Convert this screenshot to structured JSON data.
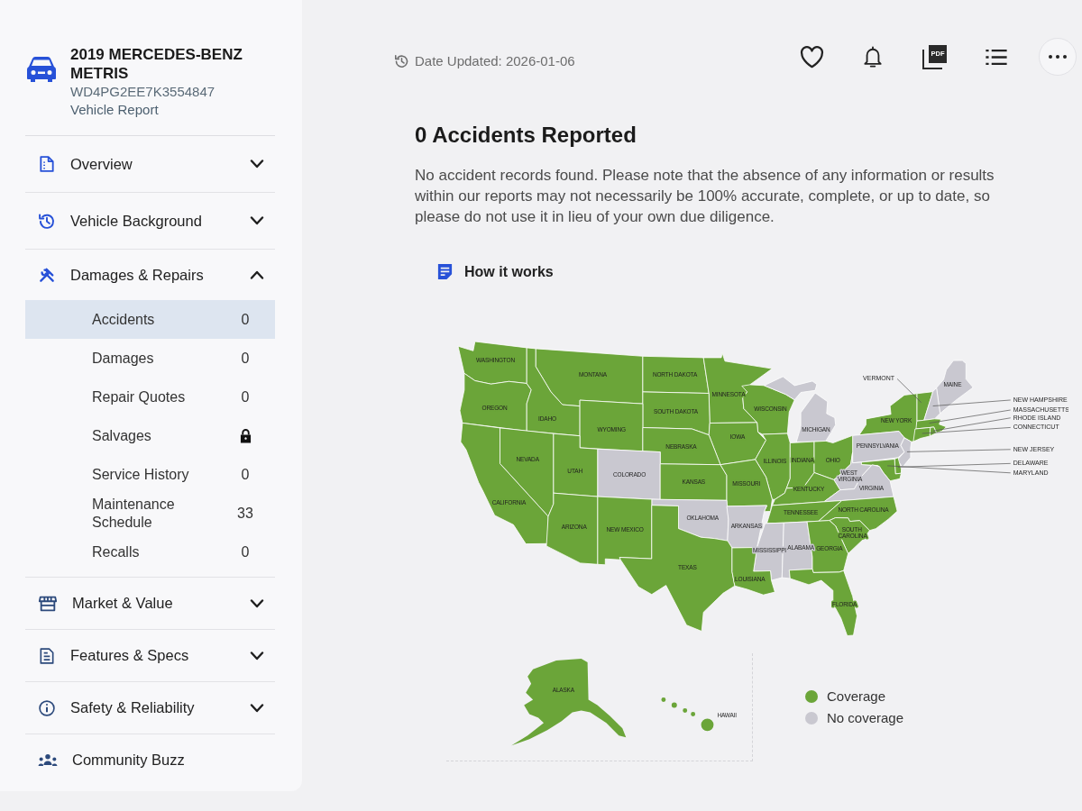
{
  "vehicle": {
    "title": "2019 MERCEDES-BENZ METRIS",
    "vin": "WD4PG2EE7K3554847",
    "subtitle": "Vehicle Report"
  },
  "sidebar": {
    "sections": [
      {
        "label": "Overview",
        "expanded": false
      },
      {
        "label": "Vehicle Background",
        "expanded": false
      },
      {
        "label": "Damages & Repairs",
        "expanded": true,
        "children": [
          {
            "label": "Accidents",
            "count": "0",
            "selected": true,
            "locked": false
          },
          {
            "label": "Damages",
            "count": "0",
            "selected": false,
            "locked": false
          },
          {
            "label": "Repair Quotes",
            "count": "0",
            "selected": false,
            "locked": false
          },
          {
            "label": "Salvages",
            "selected": false,
            "locked": true
          },
          {
            "label": "Service History",
            "count": "0",
            "selected": false,
            "locked": false
          },
          {
            "label": "Maintenance Schedule",
            "count": "33",
            "selected": false,
            "locked": false
          },
          {
            "label": "Recalls",
            "count": "0",
            "selected": false,
            "locked": false
          }
        ]
      },
      {
        "label": "Market & Value",
        "expanded": false
      },
      {
        "label": "Features & Specs",
        "expanded": false
      },
      {
        "label": "Safety & Reliability",
        "expanded": false
      },
      {
        "label": "Community Buzz"
      }
    ]
  },
  "header": {
    "date_updated": "Date Updated: 2026-01-06",
    "pdf_label": "PDF"
  },
  "report": {
    "heading": "0 Accidents Reported",
    "text": "No accident records found. Please note that the absence of any information or results within our reports may not necessarily be 100% accurate, complete, or up to date, so please do not use it in lieu of your own due diligence.",
    "link": "How it works"
  },
  "map": {
    "states": [
      {
        "name": "WASHINGTON",
        "covered": true
      },
      {
        "name": "MONTANA",
        "covered": true
      },
      {
        "name": "NORTH DAKOTA",
        "covered": true
      },
      {
        "name": "VERMONT",
        "covered": true
      },
      {
        "name": "MAINE",
        "covered": false
      },
      {
        "name": "MINNESOTA",
        "covered": true
      },
      {
        "name": "NEW HAMPSHIRE",
        "covered": false
      },
      {
        "name": "OREGON",
        "covered": true
      },
      {
        "name": "SOUTH DAKOTA",
        "covered": true
      },
      {
        "name": "WISCONSIN",
        "covered": true
      },
      {
        "name": "MASSACHUSETTS",
        "covered": true
      },
      {
        "name": "IDAHO",
        "covered": true
      },
      {
        "name": "NEW YORK",
        "covered": true
      },
      {
        "name": "RHODE ISLAND",
        "covered": true
      },
      {
        "name": "WYOMING",
        "covered": true
      },
      {
        "name": "MICHIGAN",
        "covered": false
      },
      {
        "name": "CONNECTICUT",
        "covered": true
      },
      {
        "name": "IOWA",
        "covered": true
      },
      {
        "name": "NEBRASKA",
        "covered": true
      },
      {
        "name": "PENNSYLVANIA",
        "covered": false
      },
      {
        "name": "NEW JERSEY",
        "covered": false
      },
      {
        "name": "NEVADA",
        "covered": true
      },
      {
        "name": "ILLINOIS",
        "covered": true
      },
      {
        "name": "INDIANA",
        "covered": true
      },
      {
        "name": "OHIO",
        "covered": true
      },
      {
        "name": "DELAWARE",
        "covered": true
      },
      {
        "name": "UTAH",
        "covered": true
      },
      {
        "name": "COLORADO",
        "covered": false
      },
      {
        "name": "WEST VIRGINIA",
        "covered": false
      },
      {
        "name": "MARYLAND",
        "covered": true
      },
      {
        "name": "KANSAS",
        "covered": true
      },
      {
        "name": "MISSOURI",
        "covered": true
      },
      {
        "name": "KENTUCKY",
        "covered": true
      },
      {
        "name": "VIRGINIA",
        "covered": false
      },
      {
        "name": "CALIFORNIA",
        "covered": true
      },
      {
        "name": "TENNESSEE",
        "covered": true
      },
      {
        "name": "NORTH CAROLINA",
        "covered": true
      },
      {
        "name": "OKLAHOMA",
        "covered": false
      },
      {
        "name": "ARIZONA",
        "covered": true
      },
      {
        "name": "NEW MEXICO",
        "covered": true
      },
      {
        "name": "ARKANSAS",
        "covered": false
      },
      {
        "name": "SOUTH CAROLINA",
        "covered": true
      },
      {
        "name": "MISSISSIPPI",
        "covered": false
      },
      {
        "name": "ALABAMA",
        "covered": false
      },
      {
        "name": "GEORGIA",
        "covered": true
      },
      {
        "name": "TEXAS",
        "covered": true
      },
      {
        "name": "LOUISIANA",
        "covered": true
      },
      {
        "name": "FLORIDA",
        "covered": true
      },
      {
        "name": "ALASKA",
        "covered": true
      },
      {
        "name": "HAWAII",
        "covered": true
      }
    ],
    "legend": [
      {
        "label": "Coverage",
        "color": "#6ba539"
      },
      {
        "label": "No coverage",
        "color": "#c9c8d0"
      }
    ]
  }
}
